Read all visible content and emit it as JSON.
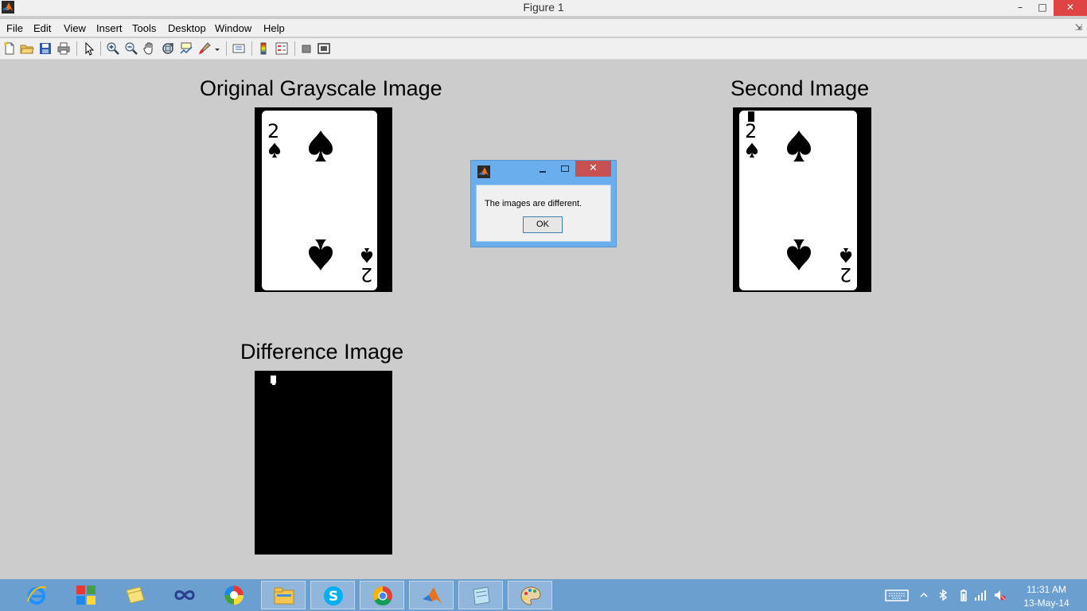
{
  "window": {
    "title": "Figure 1",
    "controls": {
      "minimize": "–",
      "maximize": "□",
      "close": "✕"
    }
  },
  "menu": [
    "File",
    "Edit",
    "View",
    "Insert",
    "Tools",
    "Desktop",
    "Window",
    "Help"
  ],
  "menu_overflow": "⇲",
  "toolbar_icons": [
    "new-figure-icon",
    "open-file-icon",
    "save-icon",
    "print-icon",
    "edit-plot-arrow-icon",
    "zoom-in-icon",
    "zoom-out-icon",
    "pan-hand-icon",
    "rotate-3d-icon",
    "data-cursor-icon",
    "brush-icon",
    "link-plot-icon",
    "colorbar-icon",
    "legend-icon",
    "hide-plot-tools-icon",
    "show-plot-tools-icon"
  ],
  "axes": {
    "original": {
      "title": "Original Grayscale Image",
      "rank": "2"
    },
    "second": {
      "title": "Second Image",
      "rank": "2"
    },
    "difference": {
      "title": "Difference Image"
    }
  },
  "dialog": {
    "message": "The images are different.",
    "ok_label": "OK",
    "close_glyph": "✕"
  },
  "taskbar": {
    "apps": [
      "internet-explorer-icon",
      "windows-store-icon",
      "folder-app-icon",
      "infinity-app-icon",
      "picasa-icon",
      "file-explorer-icon",
      "skype-icon",
      "chrome-icon",
      "matlab-icon",
      "notes-app-icon",
      "paint-icon"
    ],
    "active_app": "matlab-icon",
    "tray_icons": [
      "touch-keyboard-icon",
      "show-hidden-icons",
      "bluetooth-icon",
      "battery-icon",
      "network-icon",
      "volume-muted-icon"
    ],
    "time": "11:31 AM",
    "date": "13-May-14"
  },
  "colors": {
    "figure_bg": "#cccccc",
    "chrome_bg": "#f0f0f0",
    "dialog_frame": "#6aaeed",
    "close_red": "#c75050",
    "taskbar": "#6b9fcf"
  }
}
